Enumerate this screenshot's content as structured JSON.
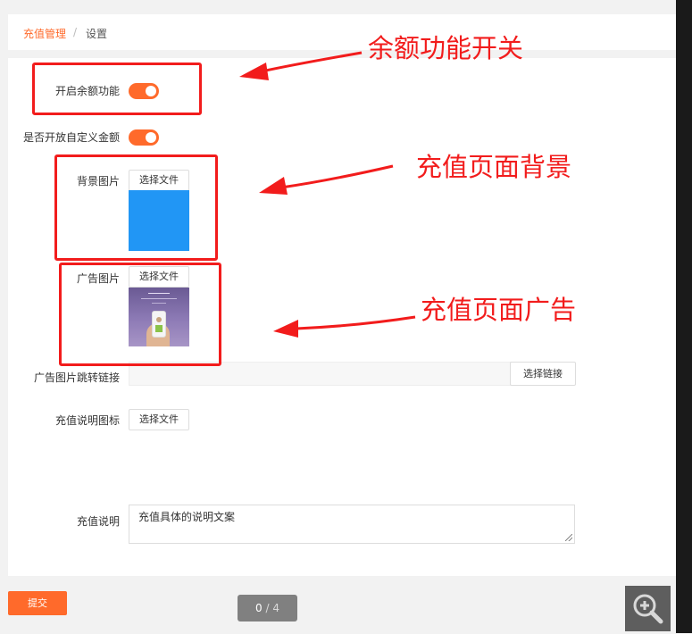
{
  "breadcrumb": {
    "home": "充值管理",
    "separator": "/",
    "current": "设置"
  },
  "form": {
    "balance_toggle_label": "开启余额功能",
    "balance_toggle_on": true,
    "custom_amount_label": "是否开放自定义金额",
    "custom_amount_on": true,
    "background_image_label": "背景图片",
    "background_file_button": "选择文件",
    "ad_image_label": "广告图片",
    "ad_file_button": "选择文件",
    "ad_link_label": "广告图片跳转链接",
    "ad_link_value": "",
    "ad_link_button": "选择链接",
    "icon_label": "充值说明图标",
    "icon_file_button": "选择文件",
    "description_label": "充值说明",
    "description_value": "充值具体的说明文案"
  },
  "actions": {
    "submit": "提交"
  },
  "pager": {
    "current": "0",
    "separator": "/",
    "total": "4"
  },
  "annotations": {
    "balance_switch": "余额功能开关",
    "page_background": "充值页面背景",
    "page_ad": "充值页面广告"
  },
  "colors": {
    "accent": "#ff6a2b",
    "annotation": "#f21c1c",
    "preview_blue": "#2196f5"
  },
  "icons": {
    "zoom": "zoom-in-icon",
    "resize": "resize-grip-icon"
  }
}
